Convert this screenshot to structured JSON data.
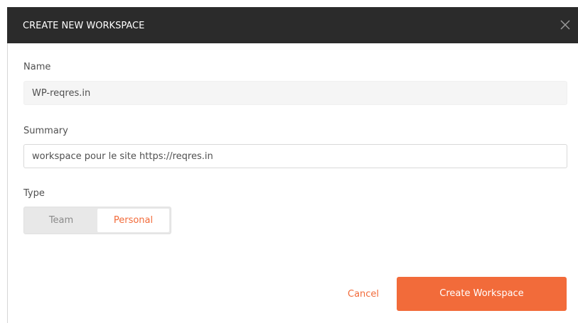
{
  "dialog": {
    "title": "CREATE NEW WORKSPACE",
    "close_icon": "close-icon"
  },
  "form": {
    "name_label": "Name",
    "name_value": "WP-reqres.in",
    "summary_label": "Summary",
    "summary_value": "workspace pour le site https://reqres.in",
    "type_label": "Type",
    "type_options": [
      "Team",
      "Personal"
    ],
    "type_selected": "Personal"
  },
  "actions": {
    "cancel_label": "Cancel",
    "create_label": "Create Workspace"
  },
  "colors": {
    "header_bg": "#2b2b2b",
    "accent": "#f26b3a"
  }
}
